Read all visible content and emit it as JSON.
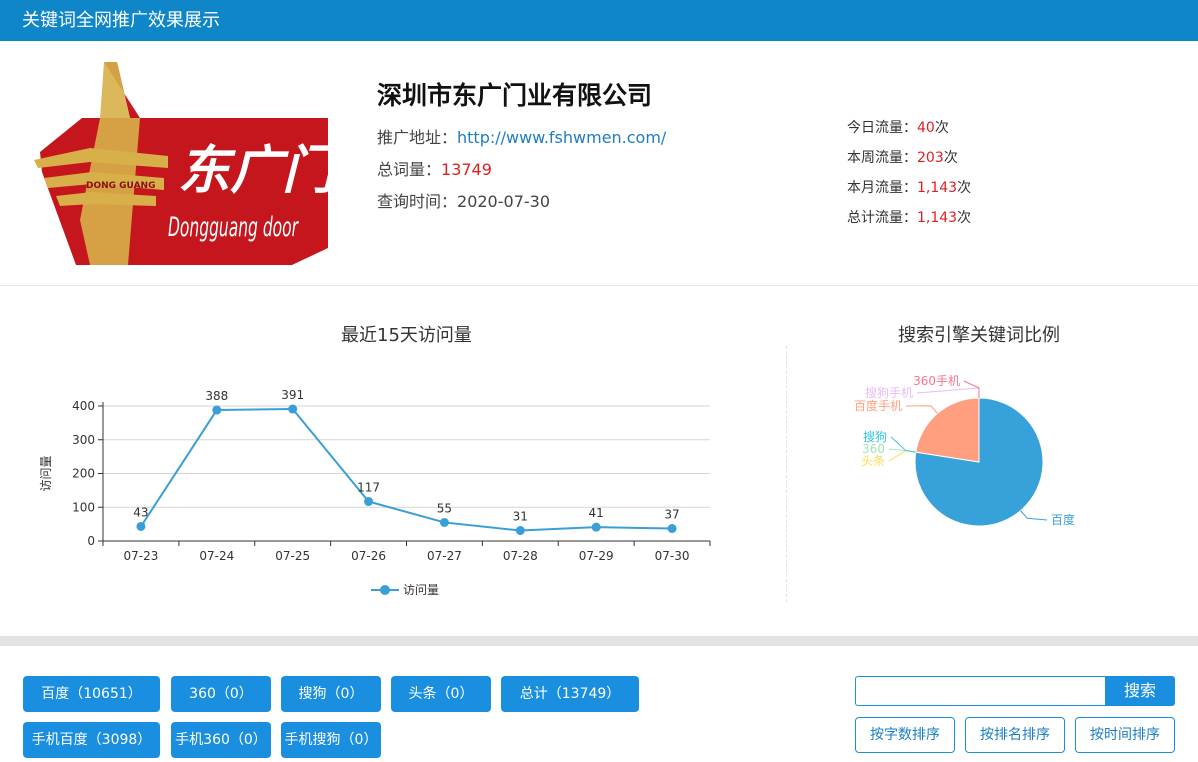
{
  "header": {
    "title": "关键词全网推广效果展示"
  },
  "logo": {
    "brand_text": "东广门业",
    "en_text": "Dongguang door",
    "badge_text": "DONG GUANG"
  },
  "company": {
    "name": "深圳市东广门业有限公司",
    "url_label": "推广地址：",
    "url": "http://www.fshwmen.com/",
    "total_words_label": "总词量：",
    "total_words": "13749",
    "query_time_label": "查询时间：",
    "query_time": "2020-07-30"
  },
  "traffic": [
    {
      "label": "今日流量：",
      "value": "40",
      "unit": "次"
    },
    {
      "label": "本周流量：",
      "value": "203",
      "unit": "次"
    },
    {
      "label": "本月流量：",
      "value": "1,143",
      "unit": "次"
    },
    {
      "label": "总计流量：",
      "value": "1,143",
      "unit": "次"
    }
  ],
  "colors": {
    "brand_blue": "#0f86c8",
    "button_blue": "#1a8fdf",
    "highlight_red": "#e02020",
    "line_series": "#3a9fd6"
  },
  "chart_data": [
    {
      "type": "line",
      "title": "最近15天访问量",
      "ylabel": "访问量",
      "categories": [
        "07-23",
        "07-24",
        "07-25",
        "07-26",
        "07-27",
        "07-28",
        "07-29",
        "07-30"
      ],
      "series": [
        {
          "name": "访问量",
          "values": [
            43,
            388,
            391,
            117,
            55,
            31,
            41,
            37
          ]
        }
      ],
      "ylim": [
        0,
        400
      ],
      "yticks": [
        "0",
        "100",
        "200",
        "300",
        "400"
      ],
      "grid": true,
      "legend": "bottom-center"
    },
    {
      "type": "pie",
      "title": "搜索引擎关键词比例",
      "labels": [
        "百度",
        "头条",
        "360",
        "搜狗",
        "百度手机",
        "搜狗手机",
        "360手机"
      ],
      "values": [
        10651,
        0,
        0,
        0,
        3098,
        0,
        0
      ],
      "colors": [
        "#37a2da",
        "#ffdb5c",
        "#9fe6b8",
        "#32c5e9",
        "#ff9f7f",
        "#e7bcf3",
        "#fb7293"
      ]
    }
  ],
  "engines": [
    {
      "label": "百度（10651）"
    },
    {
      "label": "360（0）"
    },
    {
      "label": "搜狗（0）"
    },
    {
      "label": "头条（0）"
    },
    {
      "label": "总计（13749）"
    },
    {
      "label": "手机百度（3098）"
    },
    {
      "label": "手机360（0）"
    },
    {
      "label": "手机搜狗（0）"
    }
  ],
  "search": {
    "placeholder": "",
    "button": "搜索"
  },
  "sort": [
    "按字数排序",
    "按排名排序",
    "按时间排序"
  ]
}
